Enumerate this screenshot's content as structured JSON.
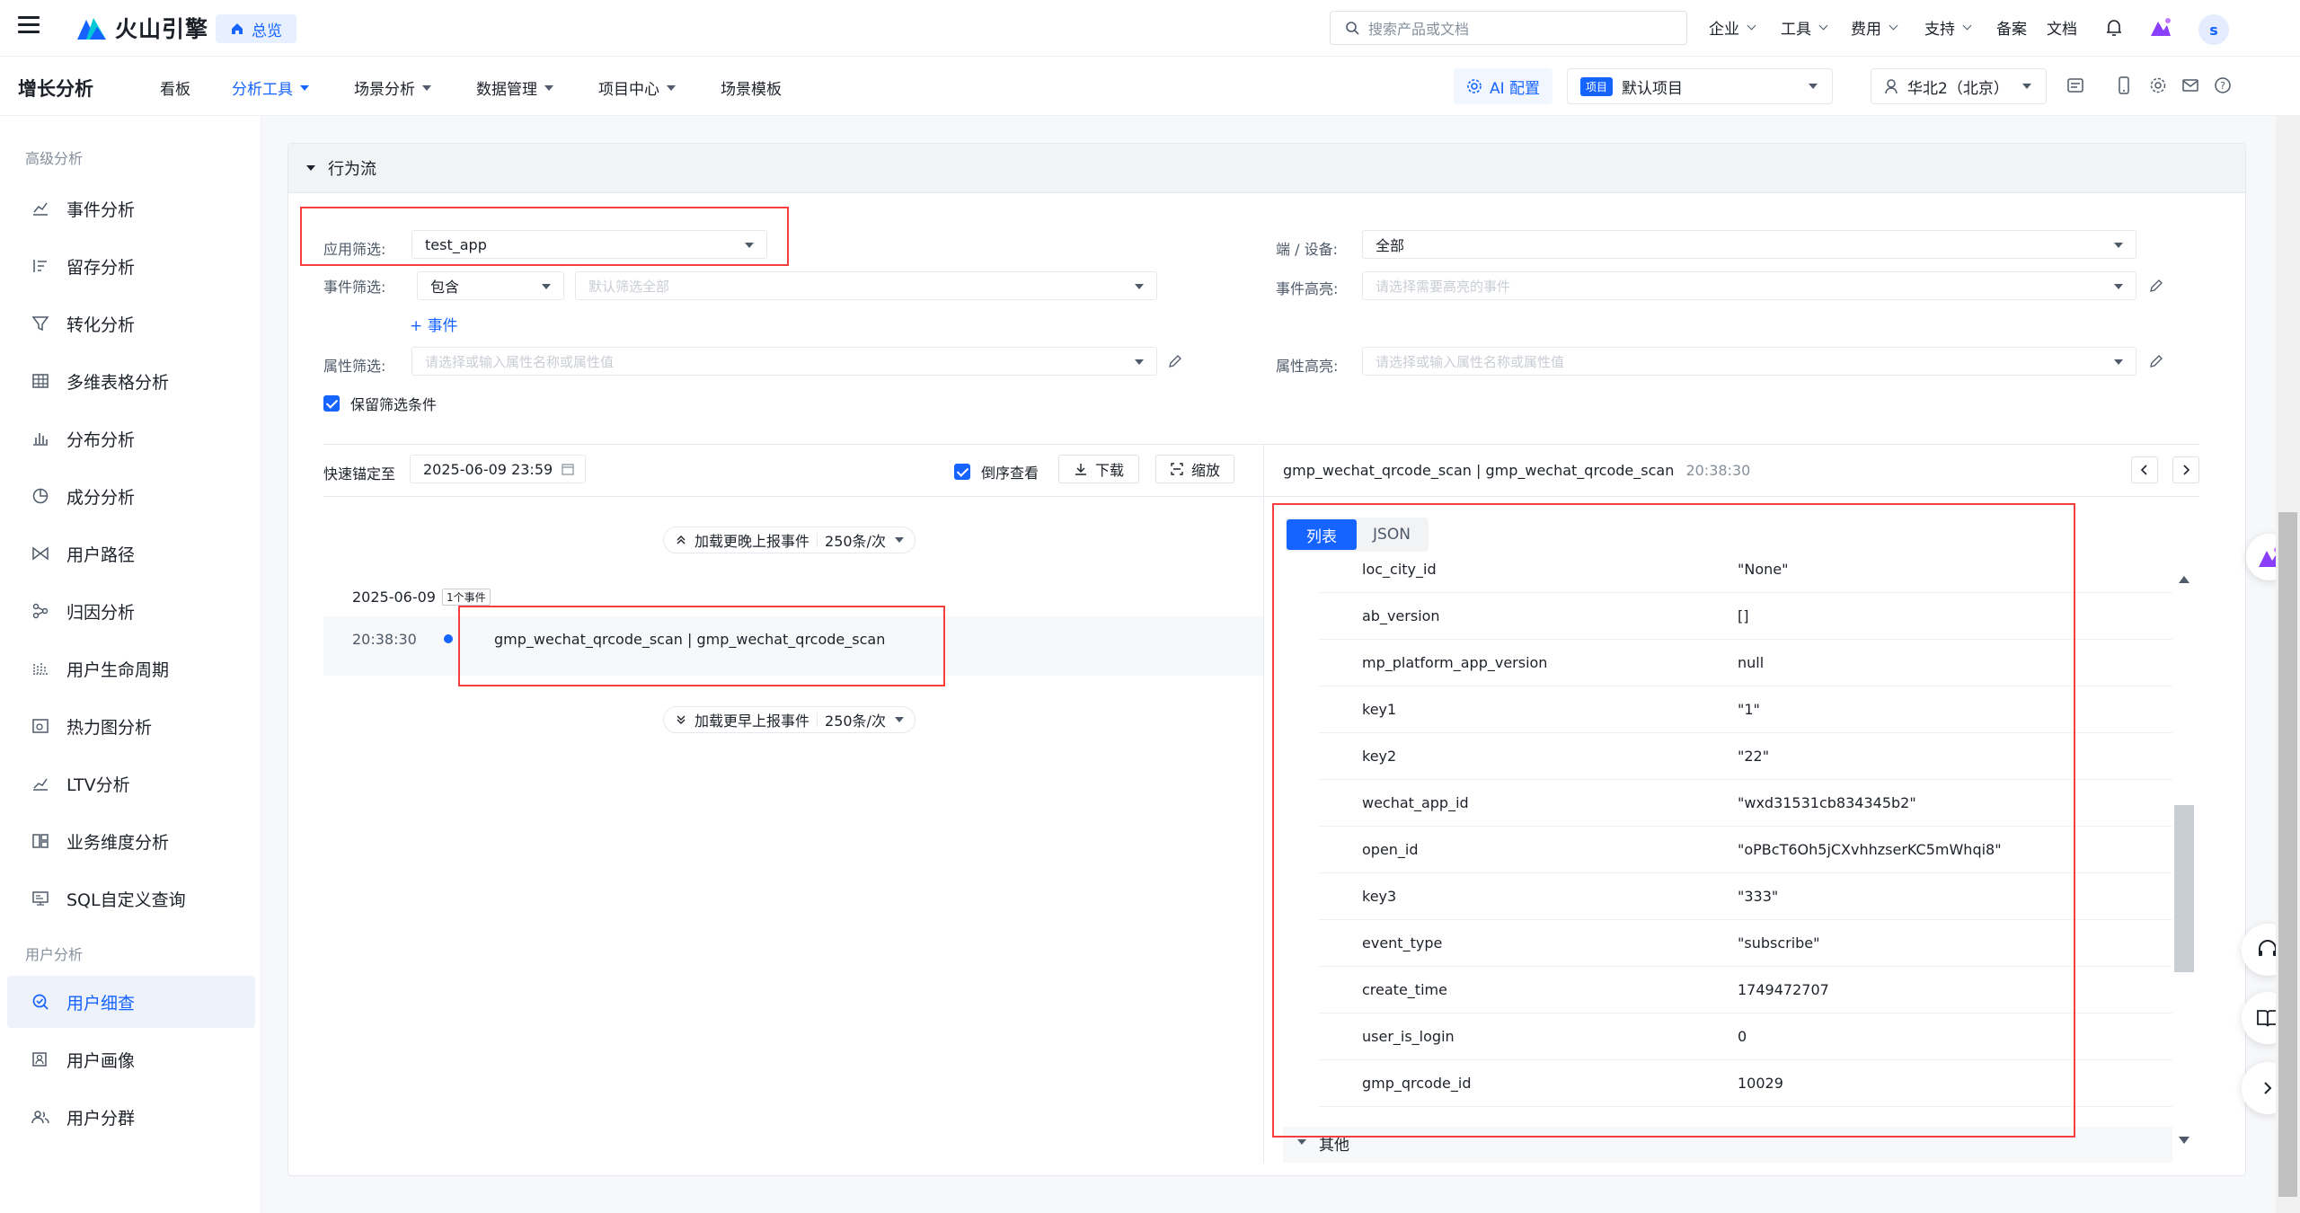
{
  "header": {
    "brand": "火山引擎",
    "home_label": "总览",
    "search_placeholder": "搜索产品或文档",
    "nav": [
      {
        "label": "企业",
        "has_menu": true
      },
      {
        "label": "工具",
        "has_menu": true
      },
      {
        "label": "费用",
        "has_menu": true
      },
      {
        "label": "支持",
        "has_menu": true
      },
      {
        "label": "备案",
        "has_menu": false
      },
      {
        "label": "文档",
        "has_menu": false
      }
    ],
    "avatar_letter": "s"
  },
  "subbar": {
    "title": "增长分析",
    "nav": [
      {
        "label": "看板",
        "has_menu": false,
        "active": false
      },
      {
        "label": "分析工具",
        "has_menu": true,
        "active": true
      },
      {
        "label": "场景分析",
        "has_menu": true,
        "active": false
      },
      {
        "label": "数据管理",
        "has_menu": true,
        "active": false
      },
      {
        "label": "项目中心",
        "has_menu": true,
        "active": false
      },
      {
        "label": "场景模板",
        "has_menu": false,
        "active": false
      }
    ],
    "ai_label": "AI 配置",
    "project_badge": "项目",
    "project_name": "默认项目",
    "region": "华北2（北京）"
  },
  "sidebar": {
    "group1": "高级分析",
    "items1": [
      {
        "label": "事件分析",
        "icon": "line-chart-icon"
      },
      {
        "label": "留存分析",
        "icon": "retention-icon"
      },
      {
        "label": "转化分析",
        "icon": "funnel-icon"
      },
      {
        "label": "多维表格分析",
        "icon": "table-icon"
      },
      {
        "label": "分布分析",
        "icon": "bar-chart-icon"
      },
      {
        "label": "成分分析",
        "icon": "pie-icon"
      },
      {
        "label": "用户路径",
        "icon": "path-icon"
      },
      {
        "label": "归因分析",
        "icon": "attribution-icon"
      },
      {
        "label": "用户生命周期",
        "icon": "lifecycle-icon"
      },
      {
        "label": "热力图分析",
        "icon": "heatmap-icon"
      },
      {
        "label": "LTV分析",
        "icon": "ltv-icon"
      },
      {
        "label": "业务维度分析",
        "icon": "dimension-icon"
      },
      {
        "label": "SQL自定义查询",
        "icon": "sql-icon"
      }
    ],
    "group2": "用户分析",
    "items2": [
      {
        "label": "用户细查",
        "icon": "user-search-icon",
        "active": true
      },
      {
        "label": "用户画像",
        "icon": "portrait-icon",
        "active": false
      },
      {
        "label": "用户分群",
        "icon": "group-icon",
        "active": false
      }
    ]
  },
  "panel": {
    "title": "行为流",
    "app_filter_label": "应用筛选:",
    "app_filter_value": "test_app",
    "event_filter_label": "事件筛选:",
    "event_filter_op": "包含",
    "event_filter_placeholder": "默认筛选全部",
    "add_event": "+ 事件",
    "attr_filter_label": "属性筛选:",
    "attr_filter_placeholder": "请选择或输入属性名称或属性值",
    "keep_filter": "保留筛选条件",
    "device_label": "端 / 设备:",
    "device_value": "全部",
    "event_highlight_label": "事件高亮:",
    "event_highlight_placeholder": "请选择需要高亮的事件",
    "attr_highlight_label": "属性高亮:",
    "attr_highlight_placeholder": "请选择或输入属性名称或属性值"
  },
  "timeline": {
    "locate_label": "快速锚定至",
    "locate_value": "2025-06-09 23:59",
    "reverse_label": "倒序查看",
    "download_label": "下载",
    "zoom_label": "缩放",
    "load_later": "加载更晚上报事件",
    "load_earlier": "加载更早上报事件",
    "page_size": "250条/次",
    "date": "2025-06-09",
    "event_count": "1个事件",
    "event_time": "20:38:30",
    "event_name": "gmp_wechat_qrcode_scan | gmp_wechat_qrcode_scan"
  },
  "detail": {
    "title": "gmp_wechat_qrcode_scan | gmp_wechat_qrcode_scan",
    "time": "20:38:30",
    "tabs": [
      "列表",
      "JSON"
    ],
    "rows": [
      {
        "k": "loc_city_id",
        "v": "\"None\""
      },
      {
        "k": "ab_version",
        "v": "[]"
      },
      {
        "k": "mp_platform_app_version",
        "v": "null"
      },
      {
        "k": "key1",
        "v": "\"1\""
      },
      {
        "k": "key2",
        "v": "\"22\""
      },
      {
        "k": "wechat_app_id",
        "v": "\"wxd31531cb834345b2\""
      },
      {
        "k": "open_id",
        "v": "\"oPBcT6Oh5jCXvhhzserKC5mWhqi8\""
      },
      {
        "k": "key3",
        "v": "\"333\""
      },
      {
        "k": "event_type",
        "v": "\"subscribe\""
      },
      {
        "k": "create_time",
        "v": "1749472707"
      },
      {
        "k": "user_is_login",
        "v": "0"
      },
      {
        "k": "gmp_qrcode_id",
        "v": "10029"
      }
    ],
    "other_section": "其他"
  },
  "colors": {
    "accent": "#1664ff",
    "highlight": "#f53f3f",
    "sidebar_active_bg": "#eef2fa"
  }
}
